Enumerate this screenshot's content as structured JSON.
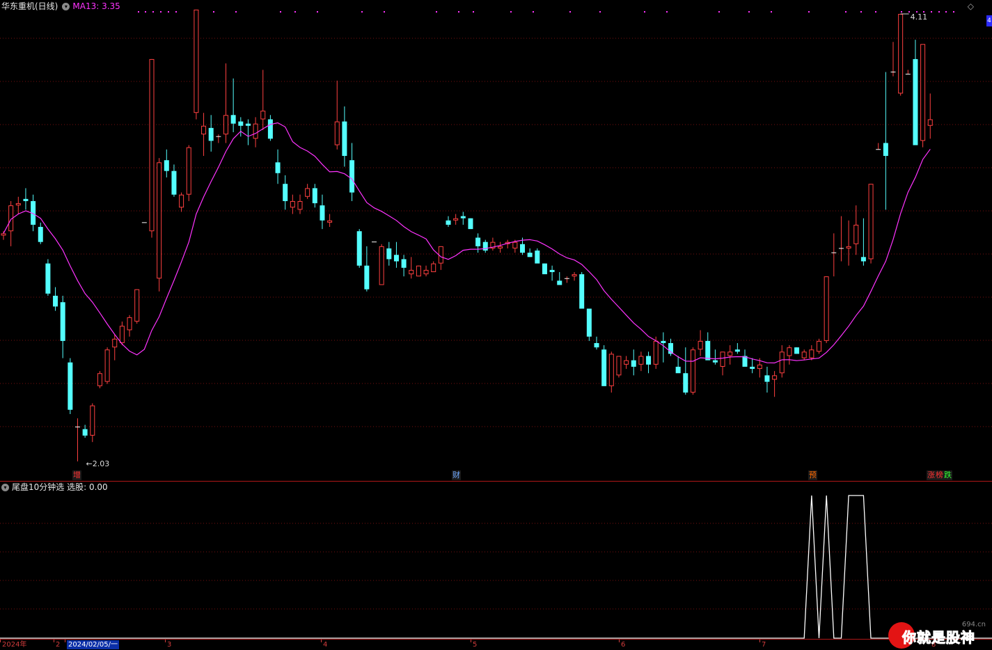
{
  "header": {
    "stock_title": "华东重机(日线)",
    "ma_label": "MA13: 3.35",
    "top_right_icon": "diamond-icon"
  },
  "indicator": {
    "title": "尾盘10分钟选",
    "value_label": "选股: 0.00"
  },
  "price_labels": {
    "high": "4.11",
    "low": "2.03"
  },
  "event_markers": [
    {
      "text": "增",
      "color": "#ff3333"
    },
    {
      "text": "财",
      "color": "#6fa8ff"
    },
    {
      "text": "预",
      "color": "#ff6a00"
    },
    {
      "text": "涨",
      "color": "#ff3333"
    },
    {
      "text": "榜",
      "color": "#ff3333"
    },
    {
      "text": "跌",
      "color": "#33ff33"
    }
  ],
  "time_axis": {
    "ticks": [
      "2024年",
      "2",
      "2024/02/05/一",
      "3",
      "4",
      "5",
      "6",
      "7",
      "8"
    ]
  },
  "colors": {
    "up": "#ff4040",
    "down": "#54ffff",
    "ma": "#ff33ff",
    "grid": "#7a1010",
    "indicator_line": "#ffffff"
  },
  "watermark": {
    "text": "你就是股神",
    "site": "694.cn"
  },
  "chart_data": {
    "type": "candlestick",
    "title": "华东重机(日线)",
    "ma_period": 13,
    "ylim": [
      2.03,
      4.11
    ],
    "candles": [
      [
        3.08,
        3.1,
        3.06,
        3.09
      ],
      [
        3.1,
        3.24,
        3.03,
        3.22
      ],
      [
        3.22,
        3.26,
        3.18,
        3.23
      ],
      [
        3.25,
        3.3,
        3.2,
        3.24
      ],
      [
        3.24,
        3.27,
        3.1,
        3.13
      ],
      [
        3.12,
        3.14,
        3.04,
        3.05
      ],
      [
        2.95,
        2.97,
        2.8,
        2.81
      ],
      [
        2.8,
        2.84,
        2.73,
        2.75
      ],
      [
        2.77,
        2.8,
        2.51,
        2.59
      ],
      [
        2.49,
        2.51,
        2.25,
        2.27
      ],
      [
        2.19,
        2.23,
        2.03,
        2.19
      ],
      [
        2.18,
        2.2,
        2.14,
        2.15
      ],
      [
        2.15,
        2.3,
        2.12,
        2.29
      ],
      [
        2.38,
        2.45,
        2.37,
        2.44
      ],
      [
        2.4,
        2.56,
        2.39,
        2.55
      ],
      [
        2.56,
        2.62,
        2.5,
        2.6
      ],
      [
        2.58,
        2.68,
        2.57,
        2.66
      ],
      [
        2.64,
        2.71,
        2.61,
        2.7
      ],
      [
        2.68,
        2.83,
        2.67,
        2.83
      ],
      [
        3.14,
        3.14,
        3.14,
        3.14
      ],
      [
        3.1,
        3.9,
        3.07,
        3.9
      ],
      [
        2.88,
        3.44,
        2.82,
        3.42
      ],
      [
        3.43,
        3.48,
        3.35,
        3.38
      ],
      [
        3.38,
        3.41,
        3.26,
        3.27
      ],
      [
        3.21,
        3.28,
        3.19,
        3.27
      ],
      [
        3.27,
        3.5,
        3.24,
        3.49
      ],
      [
        3.65,
        4.13,
        3.62,
        4.13
      ],
      [
        3.55,
        3.65,
        3.45,
        3.59
      ],
      [
        3.58,
        3.64,
        3.47,
        3.52
      ],
      [
        3.54,
        3.55,
        3.51,
        3.54
      ],
      [
        3.55,
        3.88,
        3.51,
        3.64
      ],
      [
        3.64,
        3.81,
        3.56,
        3.6
      ],
      [
        3.61,
        3.63,
        3.54,
        3.59
      ],
      [
        3.6,
        3.62,
        3.5,
        3.59
      ],
      [
        3.53,
        3.63,
        3.49,
        3.6
      ],
      [
        3.62,
        3.85,
        3.57,
        3.66
      ],
      [
        3.62,
        3.64,
        3.52,
        3.53
      ],
      [
        3.42,
        3.48,
        3.32,
        3.37
      ],
      [
        3.32,
        3.36,
        3.2,
        3.24
      ],
      [
        3.21,
        3.27,
        3.18,
        3.24
      ],
      [
        3.2,
        3.27,
        3.18,
        3.24
      ],
      [
        3.26,
        3.32,
        3.25,
        3.3
      ],
      [
        3.3,
        3.32,
        3.21,
        3.23
      ],
      [
        3.22,
        3.27,
        3.11,
        3.15
      ],
      [
        3.14,
        3.18,
        3.12,
        3.15
      ],
      [
        3.5,
        3.8,
        3.48,
        3.61
      ],
      [
        3.61,
        3.68,
        3.4,
        3.45
      ],
      [
        3.43,
        3.51,
        3.24,
        3.28
      ],
      [
        3.1,
        3.11,
        2.93,
        2.94
      ],
      [
        2.94,
        3.03,
        2.82,
        2.83
      ],
      [
        3.05,
        3.05,
        3.05,
        3.05
      ],
      [
        2.85,
        3.04,
        2.85,
        3.03
      ],
      [
        3.02,
        3.05,
        2.94,
        2.97
      ],
      [
        2.99,
        3.05,
        2.93,
        2.96
      ],
      [
        2.97,
        2.99,
        2.89,
        2.93
      ],
      [
        2.9,
        2.98,
        2.88,
        2.92
      ],
      [
        2.89,
        2.94,
        2.89,
        2.94
      ],
      [
        2.9,
        2.94,
        2.89,
        2.92
      ],
      [
        2.91,
        2.96,
        2.91,
        2.95
      ],
      [
        2.95,
        3.03,
        2.92,
        3.03
      ],
      [
        3.15,
        3.17,
        3.12,
        3.13
      ],
      [
        3.15,
        3.18,
        3.13,
        3.16
      ],
      [
        3.17,
        3.19,
        3.13,
        3.16
      ],
      [
        3.16,
        3.16,
        3.11,
        3.11
      ],
      [
        3.07,
        3.09,
        3.0,
        3.03
      ],
      [
        3.05,
        3.06,
        3.0,
        3.01
      ],
      [
        3.02,
        3.07,
        3.01,
        3.05
      ],
      [
        3.02,
        3.05,
        3.0,
        3.03
      ],
      [
        3.04,
        3.06,
        3.02,
        3.05
      ],
      [
        3.02,
        3.06,
        3.0,
        3.05
      ],
      [
        3.04,
        3.07,
        2.99,
        3.0
      ],
      [
        3.0,
        3.02,
        2.98,
        2.98
      ],
      [
        3.01,
        3.02,
        2.98,
        2.95
      ],
      [
        2.95,
        2.95,
        2.91,
        2.9
      ],
      [
        2.92,
        2.94,
        2.87,
        2.91
      ],
      [
        2.87,
        2.91,
        2.85,
        2.85
      ],
      [
        2.88,
        2.89,
        2.86,
        2.88
      ],
      [
        2.89,
        2.91,
        2.87,
        2.9
      ],
      [
        2.9,
        2.91,
        2.82,
        2.74
      ],
      [
        2.74,
        2.74,
        2.59,
        2.61
      ],
      [
        2.58,
        2.61,
        2.55,
        2.56
      ],
      [
        2.55,
        2.57,
        2.38,
        2.38
      ],
      [
        2.38,
        2.54,
        2.35,
        2.53
      ],
      [
        2.43,
        2.52,
        2.42,
        2.52
      ],
      [
        2.48,
        2.52,
        2.46,
        2.5
      ],
      [
        2.5,
        2.55,
        2.43,
        2.47
      ],
      [
        2.48,
        2.54,
        2.45,
        2.52
      ],
      [
        2.52,
        2.54,
        2.44,
        2.48
      ],
      [
        2.48,
        2.61,
        2.46,
        2.59
      ],
      [
        2.59,
        2.63,
        2.49,
        2.58
      ],
      [
        2.58,
        2.6,
        2.52,
        2.53
      ],
      [
        2.47,
        2.52,
        2.45,
        2.44
      ],
      [
        2.44,
        2.56,
        2.34,
        2.35
      ],
      [
        2.35,
        2.56,
        2.34,
        2.55
      ],
      [
        2.55,
        2.64,
        2.52,
        2.59
      ],
      [
        2.59,
        2.63,
        2.53,
        2.5
      ],
      [
        2.5,
        2.55,
        2.48,
        2.49
      ],
      [
        2.47,
        2.54,
        2.43,
        2.54
      ],
      [
        2.52,
        2.57,
        2.48,
        2.54
      ],
      [
        2.55,
        2.58,
        2.53,
        2.54
      ],
      [
        2.52,
        2.55,
        2.49,
        2.47
      ],
      [
        2.47,
        2.51,
        2.44,
        2.46
      ],
      [
        2.46,
        2.51,
        2.42,
        2.48
      ],
      [
        2.43,
        2.47,
        2.35,
        2.4
      ],
      [
        2.41,
        2.45,
        2.33,
        2.43
      ],
      [
        2.44,
        2.57,
        2.42,
        2.54
      ],
      [
        2.52,
        2.57,
        2.48,
        2.56
      ],
      [
        2.56,
        2.56,
        2.53,
        2.53
      ],
      [
        2.51,
        2.55,
        2.5,
        2.54
      ],
      [
        2.51,
        2.57,
        2.5,
        2.55
      ],
      [
        2.54,
        2.6,
        2.53,
        2.59
      ],
      [
        2.59,
        2.89,
        2.58,
        2.89
      ],
      [
        3.0,
        3.09,
        2.89,
        3.0
      ],
      [
        3.02,
        3.17,
        2.96,
        3.02
      ],
      [
        3.02,
        3.15,
        2.94,
        3.03
      ],
      [
        3.04,
        3.22,
        2.99,
        3.13
      ],
      [
        2.98,
        3.16,
        2.94,
        2.96
      ],
      [
        2.97,
        3.32,
        2.95,
        3.32
      ],
      [
        3.48,
        3.51,
        3.48,
        3.48
      ],
      [
        3.51,
        3.84,
        3.2,
        3.45
      ],
      [
        3.84,
        3.98,
        3.82,
        3.84
      ],
      [
        3.74,
        3.73,
        4.11,
        4.11
      ],
      [
        3.83,
        3.85,
        3.83,
        3.83
      ],
      [
        3.9,
        3.99,
        3.52,
        3.5
      ],
      [
        3.52,
        3.91,
        3.49,
        3.97
      ],
      [
        3.59,
        3.74,
        3.53,
        3.62
      ]
    ],
    "indicator_series": {
      "name": "选股",
      "values_last": [
        0,
        0,
        0,
        0,
        0,
        0,
        0,
        0,
        0,
        1,
        0,
        1,
        0,
        0,
        1,
        1,
        1,
        0,
        0,
        0,
        0,
        0,
        0,
        0,
        0,
        0
      ]
    }
  }
}
